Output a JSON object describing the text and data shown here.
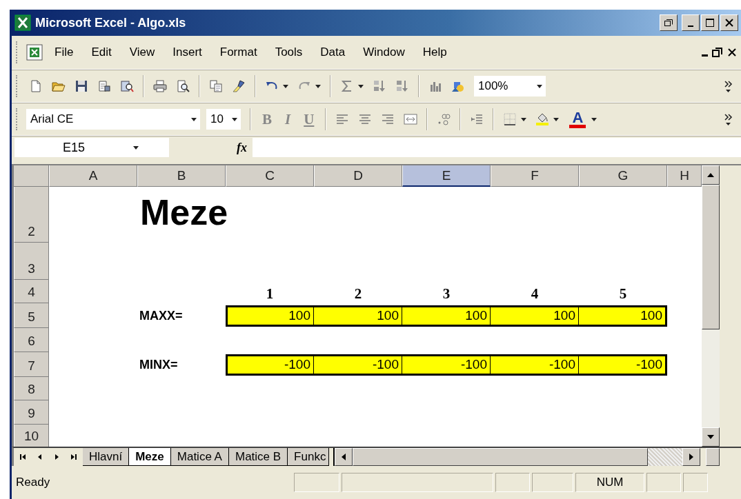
{
  "window": {
    "title": "Microsoft Excel - Algo.xls"
  },
  "menu": [
    {
      "label": "File"
    },
    {
      "label": "Edit"
    },
    {
      "label": "View"
    },
    {
      "label": "Insert"
    },
    {
      "label": "Format"
    },
    {
      "label": "Tools"
    },
    {
      "label": "Data"
    },
    {
      "label": "Window"
    },
    {
      "label": "Help"
    }
  ],
  "standard_toolbar": [
    {
      "kind": "new"
    },
    {
      "kind": "open"
    },
    {
      "kind": "save"
    },
    {
      "kind": "permission"
    },
    {
      "kind": "research"
    },
    {
      "kind": "separator"
    },
    {
      "kind": "print"
    },
    {
      "kind": "preview"
    },
    {
      "kind": "separator"
    },
    {
      "kind": "copy"
    },
    {
      "kind": "painter"
    },
    {
      "kind": "separator"
    },
    {
      "kind": "undo",
      "dropdown": true
    },
    {
      "kind": "redo",
      "dropdown": true
    },
    {
      "kind": "separator"
    },
    {
      "kind": "sum",
      "dropdown": true
    },
    {
      "kind": "sort-asc"
    },
    {
      "kind": "sort-desc"
    },
    {
      "kind": "separator"
    },
    {
      "kind": "chart"
    },
    {
      "kind": "drawing"
    },
    {
      "kind": "zoom",
      "value": "100%"
    },
    {
      "kind": "more"
    }
  ],
  "formatting_toolbar": [
    {
      "kind": "font",
      "value": "Arial CE"
    },
    {
      "kind": "size",
      "value": "10"
    },
    {
      "kind": "separator"
    },
    {
      "kind": "bold",
      "label": "B"
    },
    {
      "kind": "italic",
      "label": "I"
    },
    {
      "kind": "underline",
      "label": "U"
    },
    {
      "kind": "separator"
    },
    {
      "kind": "align-left"
    },
    {
      "kind": "align-center"
    },
    {
      "kind": "align-right"
    },
    {
      "kind": "merge"
    },
    {
      "kind": "separator"
    },
    {
      "kind": "decimal"
    },
    {
      "kind": "separator"
    },
    {
      "kind": "indent"
    },
    {
      "kind": "separator"
    },
    {
      "kind": "borders",
      "dropdown": true
    },
    {
      "kind": "fill",
      "dropdown": true
    },
    {
      "kind": "font-color",
      "label": "A",
      "dropdown": true
    },
    {
      "kind": "more"
    }
  ],
  "formula_bar": {
    "name_box": "E15",
    "function_label": "fx"
  },
  "sheet": {
    "columns": [
      {
        "label": "A",
        "selected": false
      },
      {
        "label": "B",
        "selected": false
      },
      {
        "label": "C",
        "selected": false
      },
      {
        "label": "D",
        "selected": false
      },
      {
        "label": "E",
        "selected": true
      },
      {
        "label": "F",
        "selected": false
      },
      {
        "label": "G",
        "selected": false
      },
      {
        "label": "H",
        "selected": false
      }
    ],
    "rows": [
      {
        "label": "2"
      },
      {
        "label": "3"
      },
      {
        "label": "4"
      },
      {
        "label": "5"
      },
      {
        "label": "6"
      },
      {
        "label": "7"
      },
      {
        "label": "8"
      },
      {
        "label": "9"
      },
      {
        "label": "10"
      }
    ],
    "title": "Meze",
    "index_labels": [
      "1",
      "2",
      "3",
      "4",
      "5"
    ],
    "ranges": [
      {
        "label": "MAXX=",
        "values": [
          "100",
          "100",
          "100",
          "100",
          "100"
        ]
      },
      {
        "label": "MINX=",
        "values": [
          "-100",
          "-100",
          "-100",
          "-100",
          "-100"
        ]
      }
    ]
  },
  "sheet_tabs": [
    {
      "label": "Hlavní",
      "selected": false
    },
    {
      "label": "Meze",
      "selected": true
    },
    {
      "label": "Matice A",
      "selected": false
    },
    {
      "label": "Matice B",
      "selected": false
    },
    {
      "label": "Funkc",
      "selected": false
    }
  ],
  "status_bar": {
    "status": "Ready",
    "indicators": [
      "NUM"
    ]
  }
}
